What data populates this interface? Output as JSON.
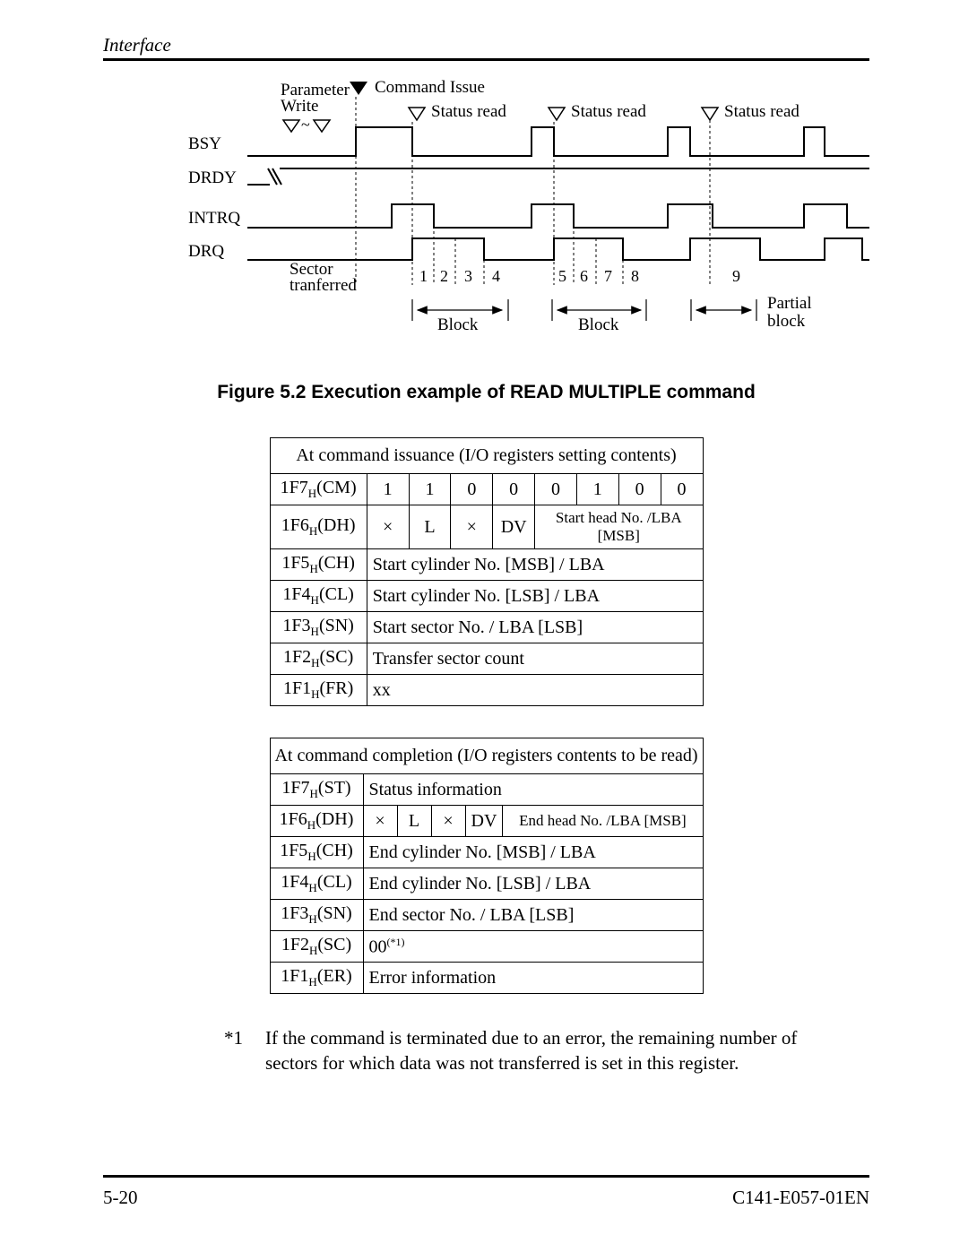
{
  "header": "Interface",
  "diagram": {
    "parameter_write": "Parameter\nWrite",
    "command_issue": "Command Issue",
    "status_read": "Status read",
    "signal_bsy": "BSY",
    "signal_drdy": "DRDY",
    "signal_intrq": "INTRQ",
    "signal_drq": "DRQ",
    "sector_transferred": "Sector\ntranferred",
    "nums": [
      "1",
      "2",
      "3",
      "4",
      "5",
      "6",
      "7",
      "8",
      "9"
    ],
    "block": "Block",
    "partial_block": "Partial\nblock"
  },
  "caption": "Figure 5.2  Execution example of READ MULTIPLE command",
  "table1": {
    "title": "At command issuance (I/O registers setting contents)",
    "rows": {
      "cm": {
        "reg": "1F7",
        "sub": "H",
        "suffix": "(CM)",
        "bits": [
          "1",
          "1",
          "0",
          "0",
          "0",
          "1",
          "0",
          "0"
        ]
      },
      "dh": {
        "reg": "1F6",
        "sub": "H",
        "suffix": "(DH)",
        "c0": "×",
        "c1": "L",
        "c2": "×",
        "c3": "DV",
        "rest": "Start head No. /LBA [MSB]"
      },
      "ch": {
        "reg": "1F5",
        "sub": "H",
        "suffix": "(CH)",
        "val": "Start cylinder No. [MSB] / LBA"
      },
      "cl": {
        "reg": "1F4",
        "sub": "H",
        "suffix": "(CL)",
        "val": "Start cylinder No. [LSB] / LBA"
      },
      "sn": {
        "reg": "1F3",
        "sub": "H",
        "suffix": "(SN)",
        "val": "Start sector No. / LBA [LSB]"
      },
      "sc": {
        "reg": "1F2",
        "sub": "H",
        "suffix": "(SC)",
        "val": "Transfer sector count"
      },
      "fr": {
        "reg": "1F1",
        "sub": "H",
        "suffix": "(FR)",
        "val": "xx"
      }
    }
  },
  "table2": {
    "title": "At command completion (I/O registers contents to be read)",
    "rows": {
      "st": {
        "reg": "1F7",
        "sub": "H",
        "suffix": "(ST)",
        "val": "Status information"
      },
      "dh": {
        "reg": "1F6",
        "sub": "H",
        "suffix": "(DH)",
        "c0": "×",
        "c1": "L",
        "c2": "×",
        "c3": "DV",
        "rest": "End head No. /LBA [MSB]"
      },
      "ch": {
        "reg": "1F5",
        "sub": "H",
        "suffix": "(CH)",
        "val": "End cylinder No. [MSB] / LBA"
      },
      "cl": {
        "reg": "1F4",
        "sub": "H",
        "suffix": "(CL)",
        "val": "End cylinder No. [LSB] / LBA"
      },
      "sn": {
        "reg": "1F3",
        "sub": "H",
        "suffix": "(SN)",
        "val": "End sector No. / LBA [LSB]"
      },
      "sc": {
        "reg": "1F2",
        "sub": "H",
        "suffix": "(SC)",
        "val": "00",
        "sup": "(*1)"
      },
      "er": {
        "reg": "1F1",
        "sub": "H",
        "suffix": "(ER)",
        "val": "Error information"
      }
    }
  },
  "footnote": {
    "marker": "*1",
    "text": "If the command is terminated due to an error, the remaining number of sectors for which data was not transferred is set in this register."
  },
  "footer": {
    "page": "5-20",
    "docid": "C141-E057-01EN"
  }
}
